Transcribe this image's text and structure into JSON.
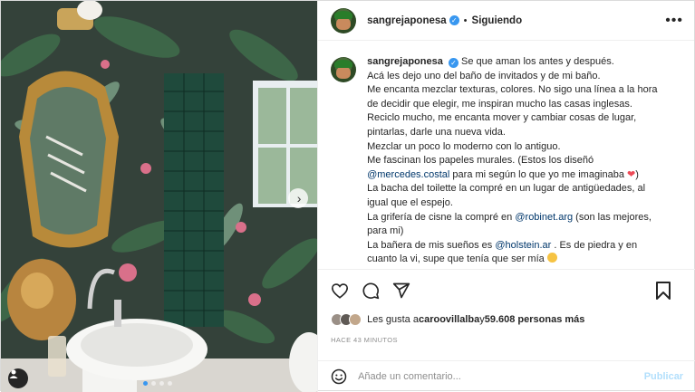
{
  "header": {
    "username": "sangrejaponesa",
    "separator": "•",
    "following_label": "Siguiendo",
    "more_label": "•••"
  },
  "caption": {
    "username": "sangrejaponesa",
    "lines": [
      "Se que aman los antes y después.",
      "Acá les dejo uno del baño de invitados y de mi baño.",
      "Me encanta mezclar texturas, colores. No sigo una línea a la hora de decidir que elegir, me inspiran mucho las casas inglesas.",
      "Reciclo mucho, me encanta mover y cambiar cosas de lugar, pintarlas, darle una nueva vida.",
      "Mezclar un poco lo moderno con lo antiguo.",
      "Me fascinan los papeles murales. (Estos los diseñó"
    ],
    "mention_1": "@mercedes.costal",
    "line_after_mention_1": " para mi según lo que yo me imaginaba ",
    "heart": "❤",
    "line_after_heart": ")",
    "line_bacha": "La bacha del toilette la compré en un lugar de antigüedades, al igual que el espejo.",
    "line_griferia_pre": "La grifería de cisne la compré en ",
    "mention_2": "@robinet.arg",
    "line_griferia_post": " (son las mejores, para mi)",
    "line_banera_pre": "La bañera de mis sueños es ",
    "mention_3": "@holstein.ar",
    "line_banera_post": " . Es de piedra y en cuanto la vi, supe que tenía que ser mía "
  },
  "actions": {
    "like": "heart-icon",
    "comment": "comment-icon",
    "share": "share-icon",
    "save": "bookmark-icon"
  },
  "likes": {
    "prefix": "Les gusta a ",
    "user": "caroovillalba",
    "middle": " y ",
    "count": "59.608 personas más"
  },
  "time": "HACE 43 MINUTOS",
  "comment": {
    "placeholder": "Añade un comentario...",
    "publish_label": "Publicar"
  },
  "colors": {
    "accent": "#3897f0",
    "publish_disabled": "#b2dffc",
    "heart": "#ed4956",
    "mention": "#00376b"
  }
}
